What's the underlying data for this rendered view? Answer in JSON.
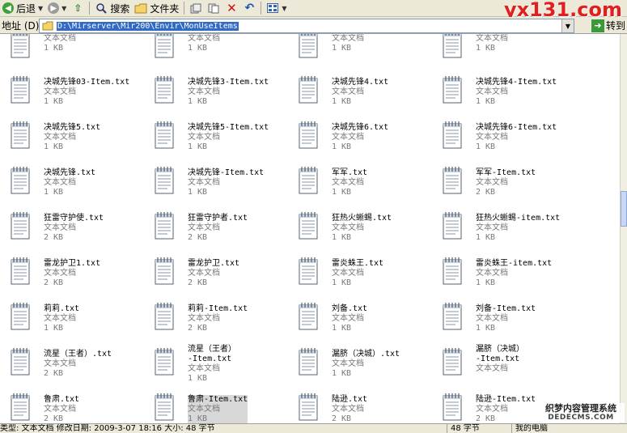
{
  "toolbar": {
    "back_label": "后退",
    "search_label": "搜索",
    "folders_label": "文件夹"
  },
  "brand": "yx131.com",
  "address": {
    "label": "地址 (D)",
    "path": "D:\\Mirserver\\Mir200\\Envir\\MonUseItems",
    "go_label": "转到"
  },
  "file_type": "文本文档",
  "files": [
    {
      "name": "",
      "size": "1 KB"
    },
    {
      "name": "",
      "size": "1 KB"
    },
    {
      "name": "",
      "size": "1 KB"
    },
    {
      "name": "",
      "size": "1 KB"
    },
    {
      "name": "决城先锋03-Item.txt",
      "size": "1 KB"
    },
    {
      "name": "决城先锋3-Item.txt",
      "size": "1 KB"
    },
    {
      "name": "决城先锋4.txt",
      "size": "1 KB"
    },
    {
      "name": "决城先锋4-Item.txt",
      "size": "1 KB"
    },
    {
      "name": "决城先锋5.txt",
      "size": "1 KB"
    },
    {
      "name": "决城先锋5-Item.txt",
      "size": "1 KB"
    },
    {
      "name": "决城先锋6.txt",
      "size": "1 KB"
    },
    {
      "name": "决城先锋6-Item.txt",
      "size": "1 KB"
    },
    {
      "name": "决城先锋.txt",
      "size": "1 KB"
    },
    {
      "name": "决城先锋-Item.txt",
      "size": "1 KB"
    },
    {
      "name": "军军.txt",
      "size": "1 KB"
    },
    {
      "name": "军军-Item.txt",
      "size": "2 KB"
    },
    {
      "name": "狂雷守护使.txt",
      "size": "2 KB"
    },
    {
      "name": "狂雷守护者.txt",
      "size": "2 KB"
    },
    {
      "name": "狂热火蜥蜴.txt",
      "size": "1 KB"
    },
    {
      "name": "狂热火蜥蜴-item.txt",
      "size": "1 KB"
    },
    {
      "name": "雷龙护卫1.txt",
      "size": "2 KB"
    },
    {
      "name": "雷龙护卫.txt",
      "size": "2 KB"
    },
    {
      "name": "雷炎蛛王.txt",
      "size": "1 KB"
    },
    {
      "name": "雷炎蛛王-item.txt",
      "size": "1 KB"
    },
    {
      "name": "莉莉.txt",
      "size": "1 KB"
    },
    {
      "name": "莉莉-Item.txt",
      "size": "2 KB"
    },
    {
      "name": "刘备.txt",
      "size": "1 KB"
    },
    {
      "name": "刘备-Item.txt",
      "size": "1 KB"
    },
    {
      "name": "流星（王者）.txt",
      "size": "2 KB"
    },
    {
      "name": "流星（王者）",
      "name2": "-Item.txt",
      "size": "1 KB"
    },
    {
      "name": "漏脐（决城）.txt",
      "size": "1 KB"
    },
    {
      "name": "漏脐（决城）",
      "name2": "-Item.txt",
      "size": ""
    },
    {
      "name": "鲁肃.txt",
      "size": "2 KB"
    },
    {
      "name": "鲁肃-Item.txt",
      "size": "1 KB",
      "selected": true
    },
    {
      "name": "陆逊.txt",
      "size": "2 KB"
    },
    {
      "name": "陆逊-Item.txt",
      "size": "2 KB"
    }
  ],
  "status": {
    "left": "类型: 文本文档 修改日期: 2009-3-07 18:16 大小: 48 字节",
    "mid": "48 字节",
    "right": "我的电脑"
  },
  "watermark": {
    "line1": "织梦内容管理系统",
    "line2": "DEDECMS.COM"
  }
}
